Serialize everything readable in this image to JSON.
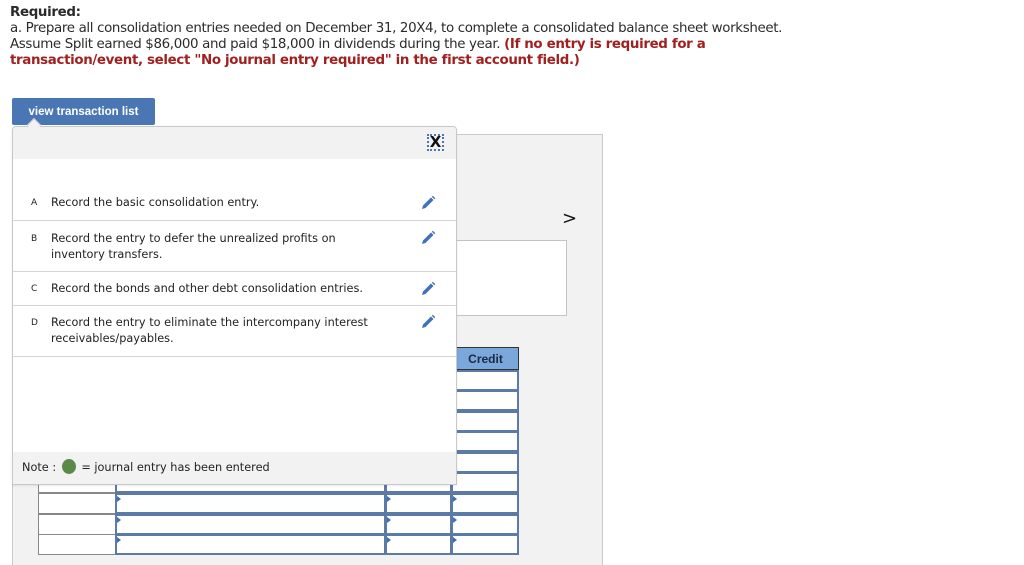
{
  "instructions": {
    "heading": "Required:",
    "body": "a. Prepare all consolidation entries needed on December 31, 20X4, to complete a consolidated balance sheet worksheet. Assume Split earned $86,000 and paid $18,000 in dividends during the year. ",
    "warning": "(If no entry is required for a transaction/event, select \"No journal entry required\" in the first account field.)"
  },
  "view_transaction_list_label": "view transaction list",
  "popup": {
    "close_label": "X",
    "transactions": [
      {
        "letter": "A",
        "text": "Record the basic consolidation entry.",
        "icon": "pencil-edit-icon"
      },
      {
        "letter": "B",
        "text": "Record the entry to defer the unrealized profits on inventory transfers.",
        "icon": "pencil-edit-icon"
      },
      {
        "letter": "C",
        "text": "Record the bonds and other debt consolidation entries.",
        "icon": "pencil-edit-icon"
      },
      {
        "letter": "D",
        "text": "Record the entry to eliminate the intercompany interest receivables/payables.",
        "icon": "pencil-edit-icon"
      }
    ],
    "note_prefix": "Note : ",
    "note_suffix": " = journal entry has been entered"
  },
  "worksheet": {
    "next_arrow": ">",
    "credit_header": "Credit"
  },
  "colors": {
    "accent_blue": "#4a77b4",
    "warning_red": "#a21f1f",
    "entered_green": "#5a8a46",
    "header_blue": "#7aa7dc"
  }
}
